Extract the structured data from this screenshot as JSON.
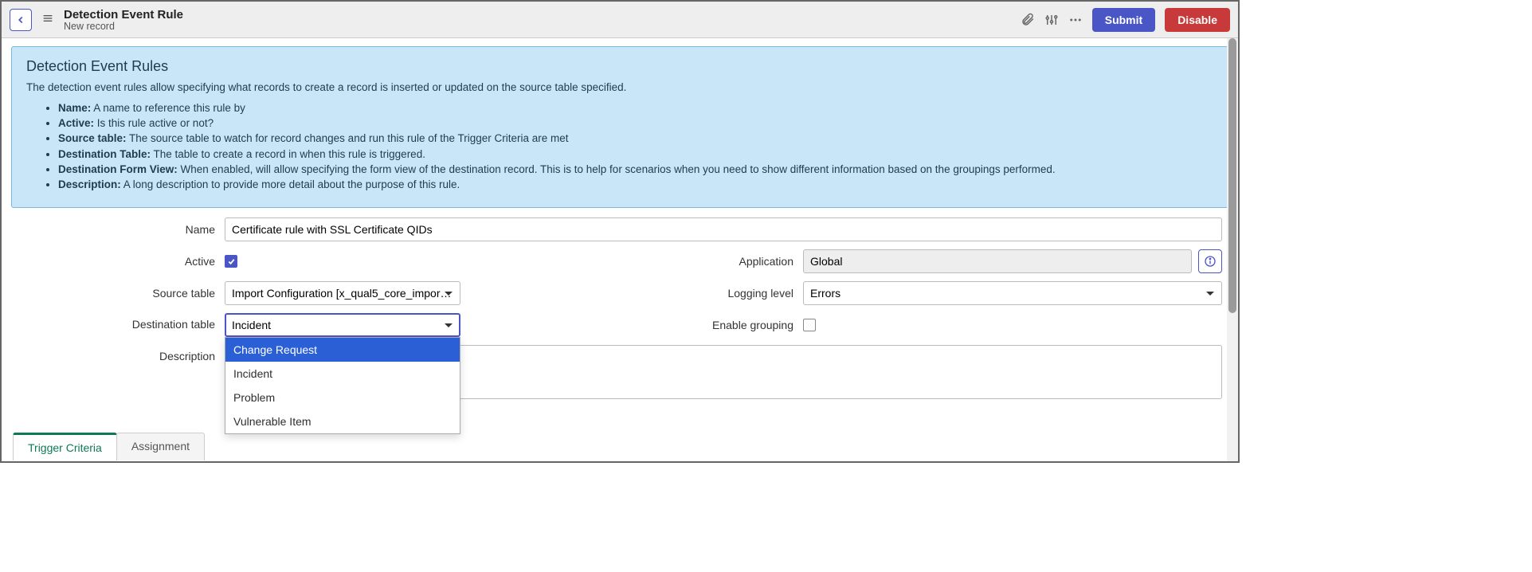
{
  "header": {
    "title": "Detection Event Rule",
    "subtitle": "New record",
    "submit_label": "Submit",
    "disable_label": "Disable"
  },
  "info_panel": {
    "title": "Detection Event Rules",
    "description": "The detection event rules allow specifying what records to create a record is inserted or updated on the source table specified.",
    "items": [
      {
        "bold": "Name:",
        "text": " A name to reference this rule by"
      },
      {
        "bold": "Active:",
        "text": " Is this rule active or not?"
      },
      {
        "bold": "Source table:",
        "text": " The source table to watch for record changes and run this rule of the Trigger Criteria are met"
      },
      {
        "bold": "Destination Table:",
        "text": " The table to create a record in when this rule is triggered."
      },
      {
        "bold": "Destination Form View:",
        "text": " When enabled, will allow specifying the form view of the destination record. This is to help for scenarios when you need to show different information based on the groupings performed."
      },
      {
        "bold": "Description:",
        "text": " A long description to provide more detail about the purpose of this rule."
      }
    ]
  },
  "form": {
    "labels": {
      "name": "Name",
      "active": "Active",
      "application": "Application",
      "source_table": "Source table",
      "logging_level": "Logging level",
      "destination_table": "Destination table",
      "enable_grouping": "Enable grouping",
      "description": "Description"
    },
    "values": {
      "name": "Certificate rule with SSL Certificate QIDs",
      "active": true,
      "application": "Global",
      "source_table": "Import Configuration [x_qual5_core_impor…",
      "logging_level": "Errors",
      "destination_table": "Incident",
      "enable_grouping": false,
      "description": ""
    },
    "destination_options": [
      "Change Request",
      "Incident",
      "Problem",
      "Vulnerable Item"
    ],
    "highlighted_option": 0
  },
  "tabs": [
    {
      "label": "Trigger Criteria",
      "active": true
    },
    {
      "label": "Assignment",
      "active": false
    }
  ]
}
